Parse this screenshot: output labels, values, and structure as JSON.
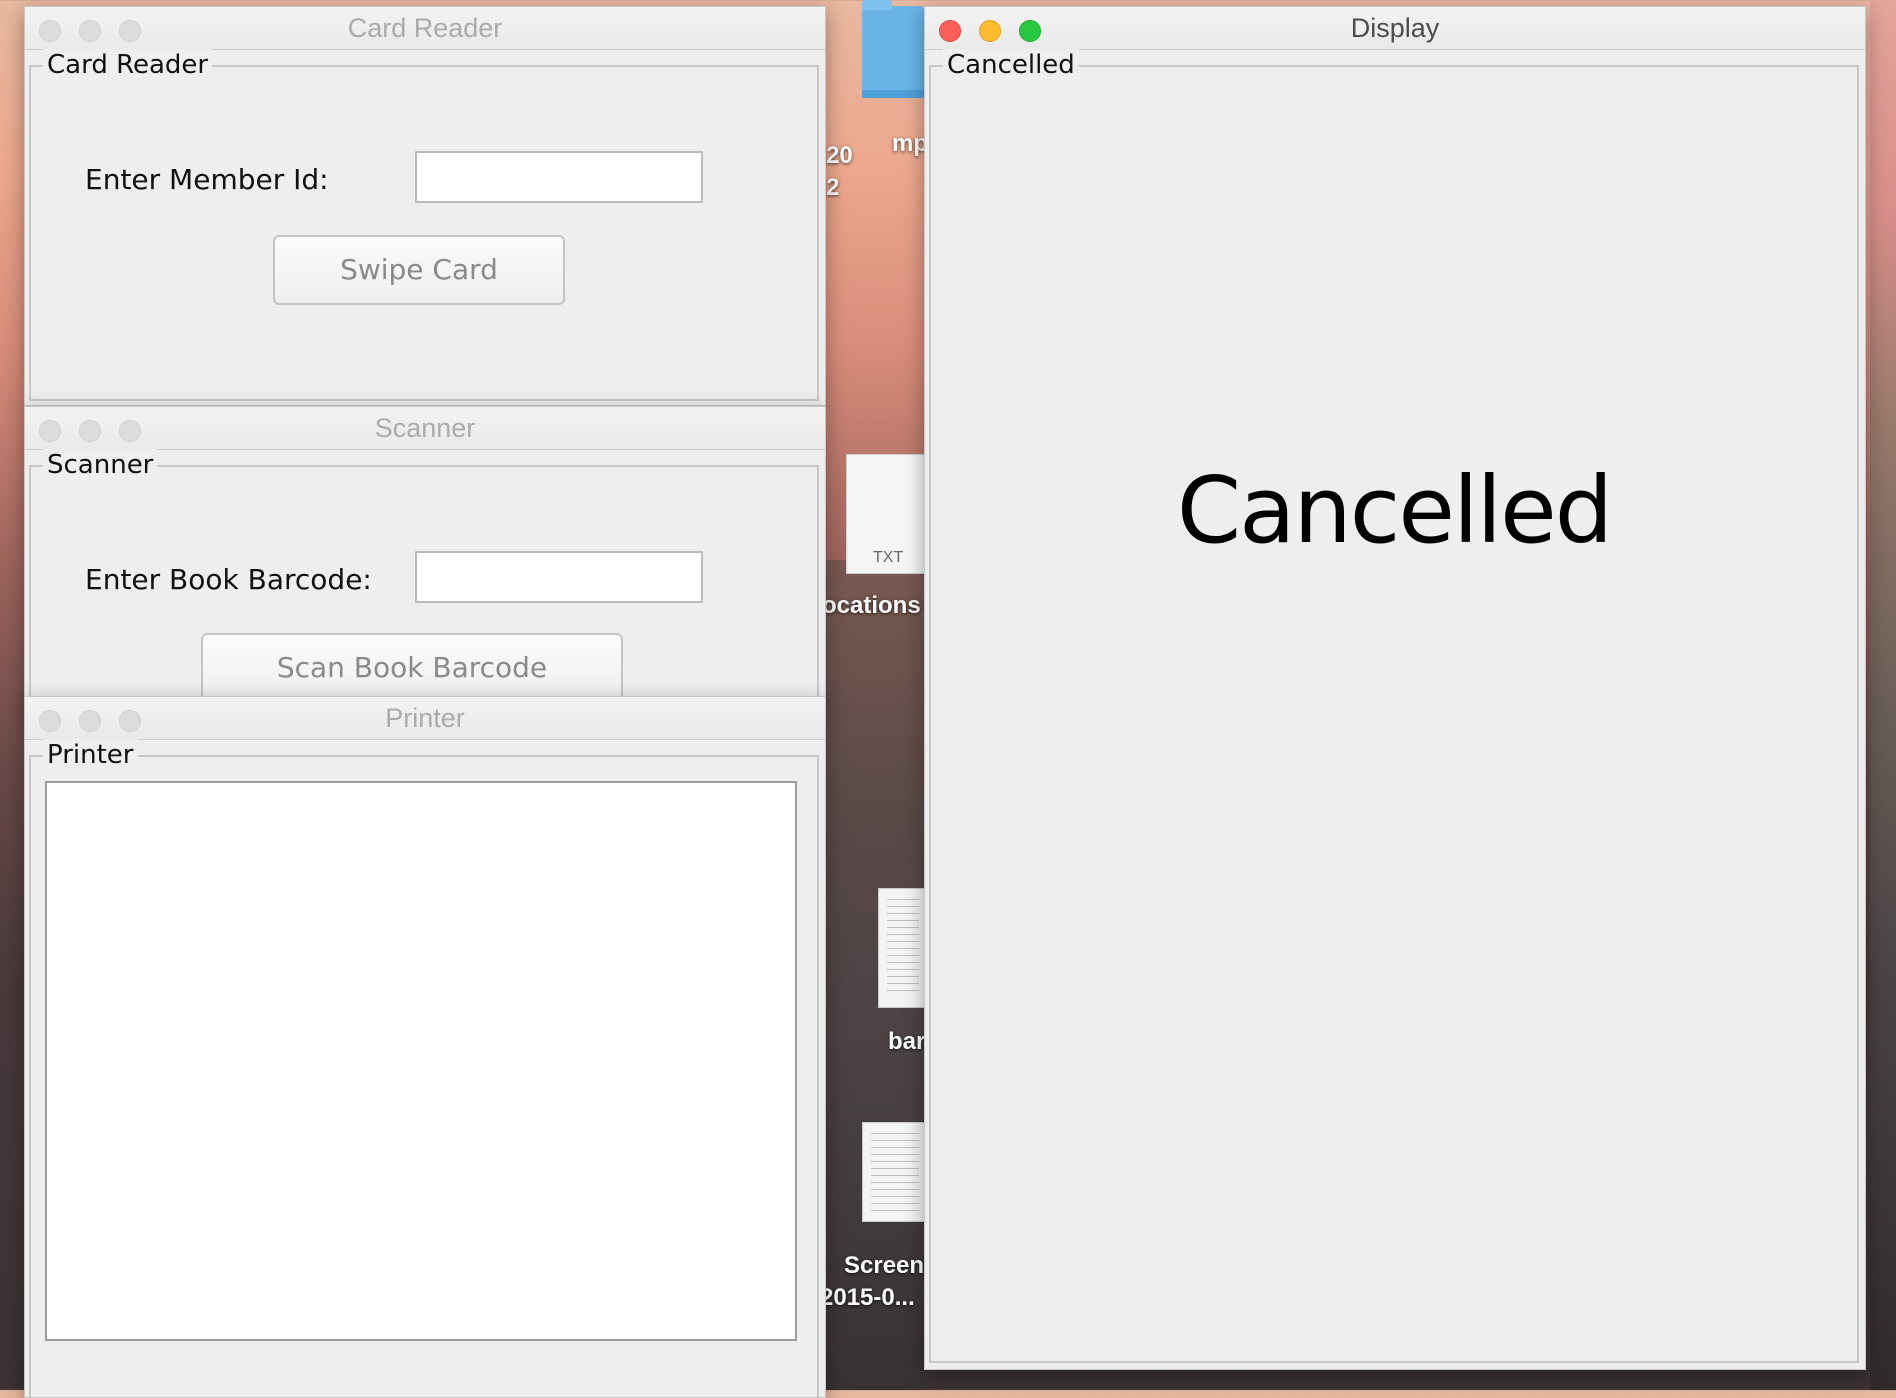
{
  "desktop": {
    "labels": [
      "20",
      "2",
      "mp",
      "ocations",
      "bar",
      "Screen",
      "2015-0..."
    ],
    "txt_tag": "TXT"
  },
  "card_reader": {
    "window_title": "Card Reader",
    "group_title": "Card Reader",
    "member_label": "Enter Member Id:",
    "member_value": "",
    "swipe_button": "Swipe Card"
  },
  "scanner": {
    "window_title": "Scanner",
    "group_title": "Scanner",
    "barcode_label": "Enter Book Barcode:",
    "barcode_value": "",
    "scan_button": "Scan Book Barcode"
  },
  "printer": {
    "window_title": "Printer",
    "group_title": "Printer",
    "output": ""
  },
  "display": {
    "window_title": "Display",
    "group_title": "Cancelled",
    "message": "Cancelled"
  }
}
